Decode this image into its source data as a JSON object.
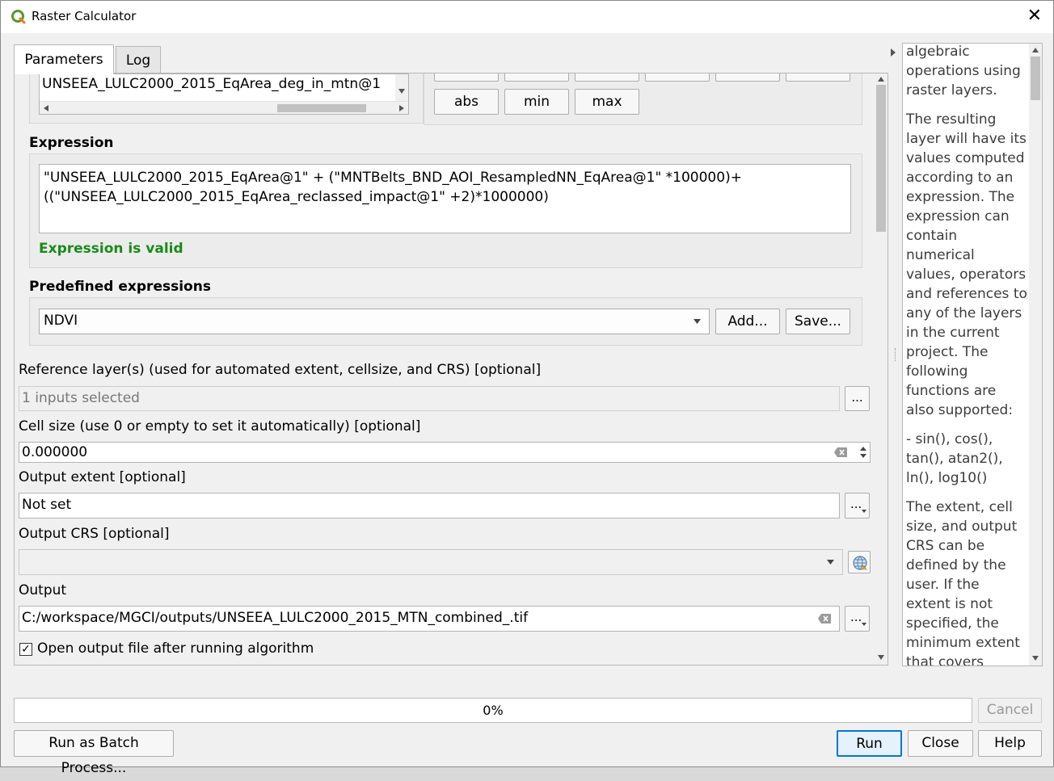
{
  "window": {
    "title": "Raster Calculator",
    "close_glyph": "✕"
  },
  "tabs": [
    {
      "label": "Parameters",
      "active": true
    },
    {
      "label": "Log",
      "active": false
    }
  ],
  "layers": {
    "visible_item": "UNSEEA_LULC2000_2015_EqArea_deg_in_mtn@1"
  },
  "operators": {
    "row2": [
      "abs",
      "min",
      "max"
    ]
  },
  "expression": {
    "label": "Expression",
    "line1": "\"UNSEEA_LULC2000_2015_EqArea@1\" + (\"MNTBelts_BND_AOI_ResampledNN_EqArea@1\" *100000)+",
    "line2": "((\"UNSEEA_LULC2000_2015_EqArea_reclassed_impact@1\" +2)*1000000)",
    "status": "Expression is valid",
    "status_color": "#1a8a1a"
  },
  "predefined": {
    "label": "Predefined expressions",
    "selected": "NDVI",
    "add_label": "Add...",
    "save_label": "Save..."
  },
  "reference_layers": {
    "label": "Reference layer(s) (used for automated extent, cellsize, and CRS) [optional]",
    "value": "1 inputs selected",
    "browse_label": "..."
  },
  "cell_size": {
    "label": "Cell size (use 0 or empty to set it automatically) [optional]",
    "value": "0.000000"
  },
  "output_extent": {
    "label": "Output extent [optional]",
    "value": "Not set",
    "browse_label": "..."
  },
  "output_crs": {
    "label": "Output CRS [optional]",
    "value": ""
  },
  "output": {
    "label": "Output",
    "value": "C:/workspace/MGCI/outputs/UNSEEA_LULC2000_2015_MTN_combined_.tif",
    "browse_label": "..."
  },
  "open_output": {
    "label": "Open output file after running algorithm",
    "checked": true,
    "check_glyph": "✓"
  },
  "help": {
    "paragraphs": [
      "algebraic operations using raster layers.",
      "The resulting layer will have its values computed according to an expression. The expression can contain numerical values, operators and references to any of the layers in the current project. The following functions are also supported:",
      "- sin(), cos(), tan(), atan2(), ln(), log10()",
      "The extent, cell size, and output CRS can be defined by the user. If the extent is not specified, the minimum extent that covers selected"
    ]
  },
  "progress": {
    "percent": 0,
    "text": "0%"
  },
  "buttons": {
    "cancel": "Cancel",
    "batch": "Run as Batch Process...",
    "run": "Run",
    "close": "Close",
    "help": "Help"
  }
}
